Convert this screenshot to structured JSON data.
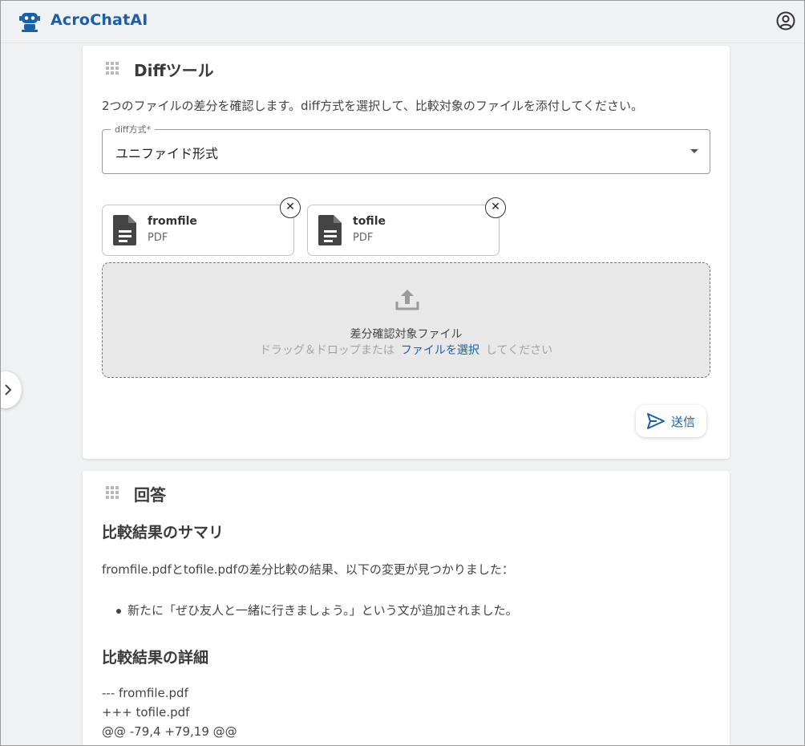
{
  "app": {
    "title": "AcroChatAI"
  },
  "icons": {
    "logo": "robot-icon",
    "account": "account-circle-icon",
    "sidebar_toggle": "chevron-right-icon",
    "grip": "drag-grid-icon",
    "file": "document-icon",
    "remove": "close-icon",
    "upload": "upload-icon",
    "send": "send-icon"
  },
  "colors": {
    "accent": "#1d5fa3",
    "background": "#f0f1f3",
    "dropzone": "#e8e8e8"
  },
  "diff_tool": {
    "title": "Diffツール",
    "description": "2つのファイルの差分を確認します。diff方式を選択して、比較対象のファイルを添付してください。",
    "select": {
      "label": "diff方式*",
      "value": "ユニファイド形式"
    },
    "files": [
      {
        "name": "fromfile",
        "type": "PDF",
        "remove": "✕"
      },
      {
        "name": "tofile",
        "type": "PDF",
        "remove": "✕"
      }
    ],
    "dropzone": {
      "title": "差分確認対象ファイル",
      "hint_before": "ドラッグ＆ドロップまたは",
      "link": "ファイルを選択",
      "hint_after": "してください"
    },
    "send_label": "送信"
  },
  "answer": {
    "title": "回答",
    "summary_heading": "比較結果のサマリ",
    "summary_text": "fromfile.pdfとtofile.pdfの差分比較の結果、以下の変更が見つかりました：",
    "bullets": [
      "新たに「ぜひ友人と一緒に行きましょう。」という文が追加されました。"
    ],
    "detail_heading": "比較結果の詳細",
    "diff_lines": [
      "--- fromfile.pdf",
      "+++ tofile.pdf",
      "@@ -79,4 +79,19 @@"
    ]
  }
}
